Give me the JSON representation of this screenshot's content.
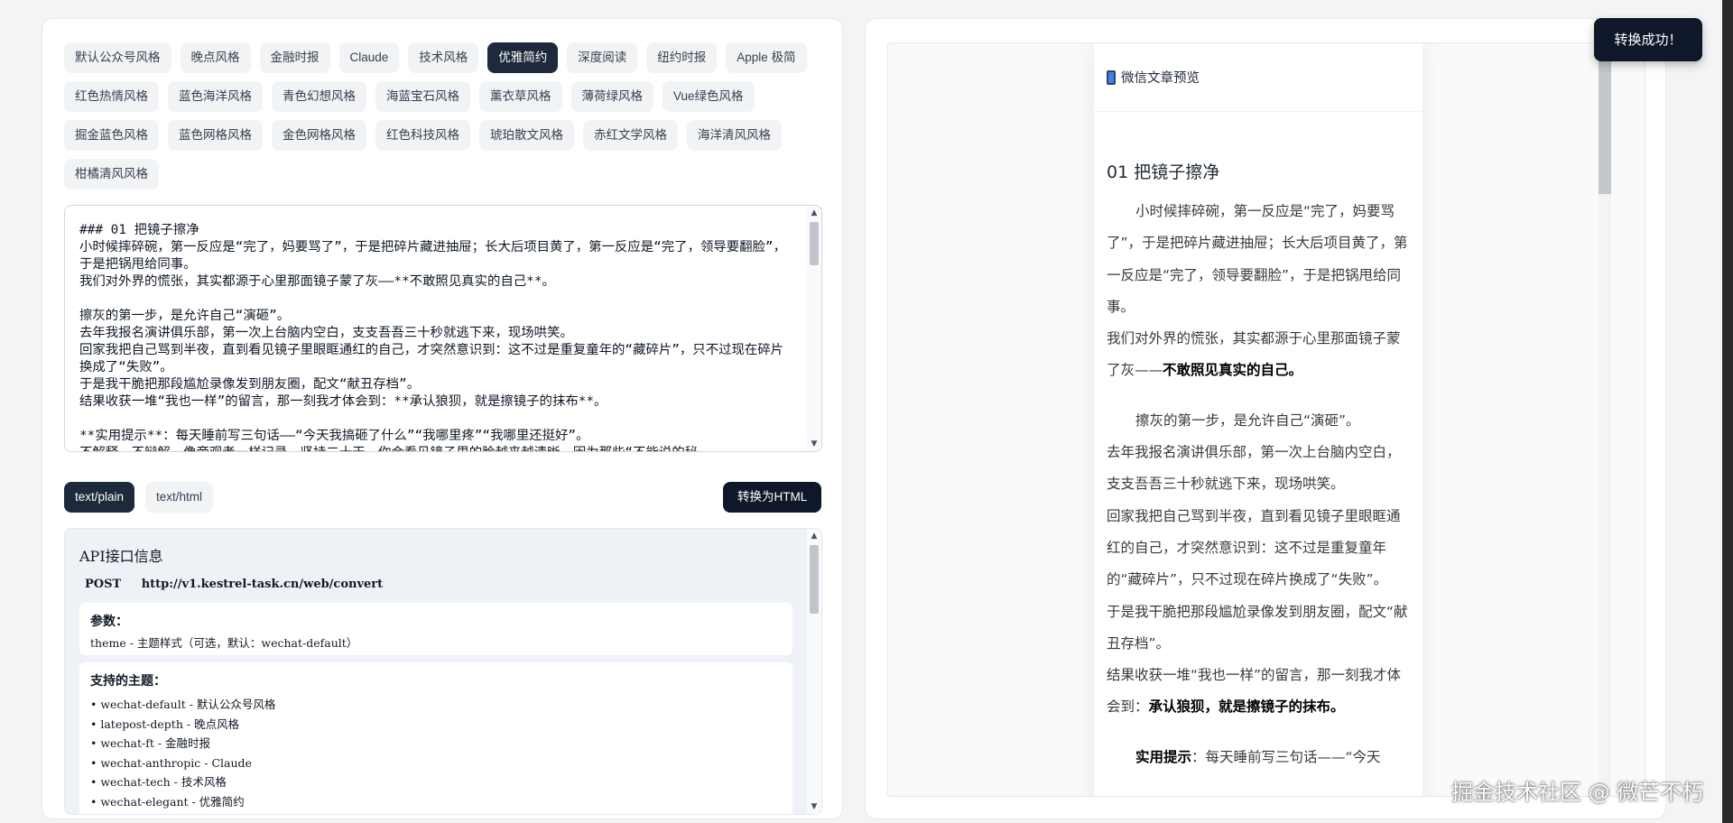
{
  "themes": [
    {
      "label": "默认公众号风格",
      "active": false
    },
    {
      "label": "晚点风格",
      "active": false
    },
    {
      "label": "金融时报",
      "active": false
    },
    {
      "label": "Claude",
      "active": false
    },
    {
      "label": "技术风格",
      "active": false
    },
    {
      "label": "优雅简约",
      "active": true
    },
    {
      "label": "深度阅读",
      "active": false
    },
    {
      "label": "纽约时报",
      "active": false
    },
    {
      "label": "Apple 极简",
      "active": false
    },
    {
      "label": "红色热情风格",
      "active": false
    },
    {
      "label": "蓝色海洋风格",
      "active": false
    },
    {
      "label": "青色幻想风格",
      "active": false
    },
    {
      "label": "海蓝宝石风格",
      "active": false
    },
    {
      "label": "薰衣草风格",
      "active": false
    },
    {
      "label": "薄荷绿风格",
      "active": false
    },
    {
      "label": "Vue绿色风格",
      "active": false
    },
    {
      "label": "掘金蓝色风格",
      "active": false
    },
    {
      "label": "蓝色网格风格",
      "active": false
    },
    {
      "label": "金色网格风格",
      "active": false
    },
    {
      "label": "红色科技风格",
      "active": false
    },
    {
      "label": "琥珀散文风格",
      "active": false
    },
    {
      "label": "赤红文学风格",
      "active": false
    },
    {
      "label": "海洋清风风格",
      "active": false
    },
    {
      "label": "柑橘清风风格",
      "active": false
    }
  ],
  "editor": {
    "content": "### 01 把镜子擦净\n小时候摔碎碗，第一反应是“完了，妈要骂了”，于是把碎片藏进抽屉；长大后项目黄了，第一反应是“完了，领导要翻脸”，于是把锅甩给同事。\n我们对外界的慌张，其实都源于心里那面镜子蒙了灰——**不敢照见真实的自己**。\n\n擦灰的第一步，是允许自己“演砸”。\n去年我报名演讲俱乐部，第一次上台脑内空白，支支吾吾三十秒就逃下来，现场哄笑。\n回家我把自己骂到半夜，直到看见镜子里眼眶通红的自己，才突然意识到：这不过是重复童年的“藏碎片”，只不过现在碎片换成了“失败”。\n于是我干脆把那段尴尬录像发到朋友圈，配文“献丑存档”。\n结果收获一堆“我也一样”的留言，那一刻我才体会到：**承认狼狈，就是擦镜子的抹布**。\n\n**实用提示**：每天睡前写三句话——“今天我搞砸了什么”“我哪里疼”“我哪里还挺好”。\n不解释，不辩解，像旁观者一样记录。坚持二十天，你会看见镜子里的脸越来越清晰，因为那些“不能说的秘"
  },
  "format": {
    "plain": "text/plain",
    "html": "text/html",
    "convert": "转换为HTML"
  },
  "api": {
    "title": "API接口信息",
    "method": "POST",
    "url": "http://v1.kestrel-task.cn/web/convert",
    "params_title": "参数：",
    "params": [
      "theme - 主题样式（可选，默认：wechat-default）"
    ],
    "themes_title": "支持的主题：",
    "supported": [
      "• wechat-default - 默认公众号风格",
      "• latepost-depth - 晚点风格",
      "• wechat-ft - 金融时报",
      "• wechat-anthropic - Claude",
      "• wechat-tech - 技术风格",
      "• wechat-elegant - 优雅简约"
    ]
  },
  "preview": {
    "header": "微信文章预览",
    "title": "01 把镜子擦净",
    "p1": "小时候摔碎碗，第一反应是“完了，妈要骂了”，于是把碎片藏进抽屉；长大后项目黄了，第一反应是“完了，领导要翻脸”，于是把锅甩给同事。",
    "p2_pre": "我们对外界的慌张，其实都源于心里那面镜子蒙了灰——",
    "p2_bold": "不敢照见真实的自己。",
    "p3": "擦灰的第一步，是允许自己“演砸”。",
    "p4": "去年我报名演讲俱乐部，第一次上台脑内空白，支支吾吾三十秒就逃下来，现场哄笑。",
    "p5": "回家我把自己骂到半夜，直到看见镜子里眼眶通红的自己，才突然意识到：这不过是重复童年的“藏碎片”，只不过现在碎片换成了“失败”。",
    "p6": "于是我干脆把那段尴尬录像发到朋友圈，配文“献丑存档”。",
    "p7_pre": "结果收获一堆“我也一样”的留言，那一刻我才体会到：",
    "p7_bold": "承认狼狈，就是擦镜子的抹布。",
    "p8_bold": "实用提示",
    "p8_rest": "：每天睡前写三句话——“今天"
  },
  "toast": "转换成功！",
  "watermark": "掘金技术社区 @ 微芒不朽"
}
